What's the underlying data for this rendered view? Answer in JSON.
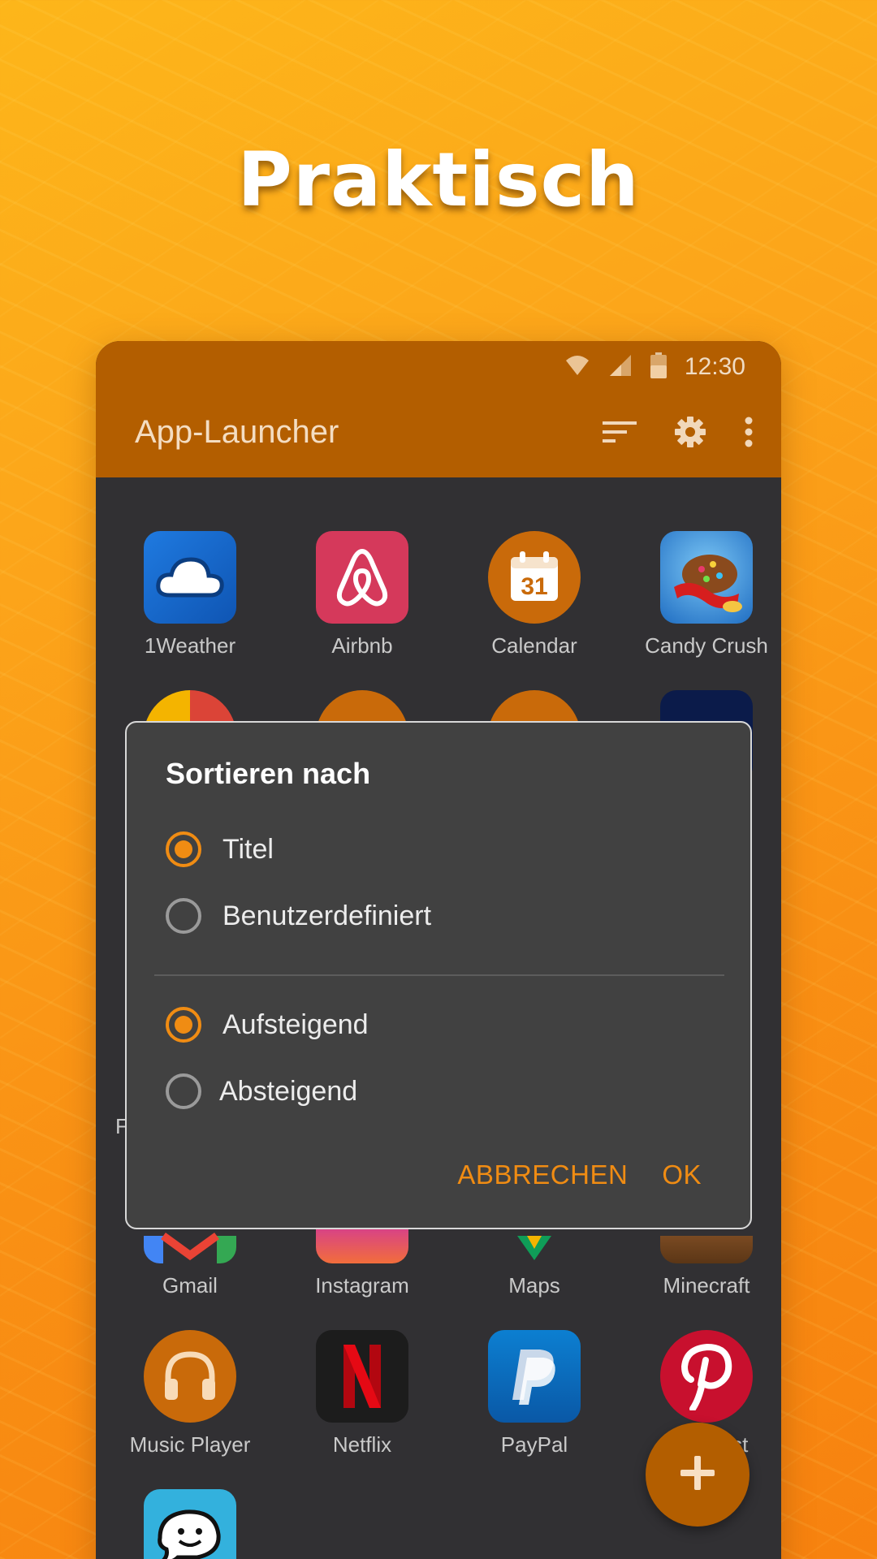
{
  "headline": "Praktisch",
  "status_bar": {
    "time": "12:30"
  },
  "toolbar": {
    "title": "App-Launcher"
  },
  "apps": {
    "row1": [
      {
        "label": "1Weather",
        "color": "#1e6fd0"
      },
      {
        "label": "Airbnb",
        "color": "#d5395b"
      },
      {
        "label": "Calendar",
        "color": "#c96a0a"
      },
      {
        "label": "Candy Crush",
        "color": "#3a8fd9"
      }
    ],
    "row4": [
      {
        "label": "Gmail"
      },
      {
        "label": "Instagram"
      },
      {
        "label": "Maps"
      },
      {
        "label": "Minecraft"
      }
    ],
    "row5": [
      {
        "label": "Music Player",
        "color": "#c96a0a"
      },
      {
        "label": "Netflix",
        "color": "#1c1c1c"
      },
      {
        "label": "PayPal",
        "color": "#0a6ebd"
      },
      {
        "label": "Pinterest",
        "color": "#c8102e"
      }
    ],
    "partial_label": "F",
    "calendar_day": "31"
  },
  "dialog": {
    "title": "Sortieren nach",
    "sort_options": [
      {
        "label": "Titel",
        "checked": true
      },
      {
        "label": "Benutzerdefiniert",
        "checked": false
      }
    ],
    "order_options": [
      {
        "label": "Aufsteigend",
        "checked": true
      },
      {
        "label": "Absteigend",
        "checked": false
      }
    ],
    "cancel_label": "ABBRECHEN",
    "ok_label": "OK"
  },
  "accent_color": "#f08c13",
  "toolbar_color": "#b35e00"
}
